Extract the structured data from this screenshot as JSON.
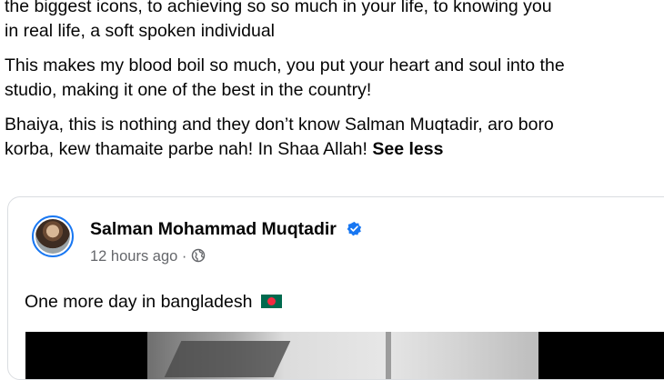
{
  "post": {
    "paragraphs": [
      {
        "lines": [
          "the biggest icons, to achieving so so much in your life, to knowing you",
          "in real life, a soft spoken individual"
        ]
      },
      {
        "lines": [
          "This makes my blood boil so much, you put your heart and soul into the",
          "studio, making it one of the best in the country!"
        ]
      },
      {
        "lines": [
          "Bhaiya, this is nothing and they don’t know Salman Muqtadir, aro boro",
          "korba, kew thamaite parbe nah! In Shaa Allah!"
        ]
      }
    ],
    "see_less_label": "See less"
  },
  "shared_post": {
    "author_name": "Salman Mohammad Muqtadir",
    "author_verified": true,
    "timestamp": "12 hours ago",
    "separator": "·",
    "audience_icon": "globe-icon",
    "caption": "One more day in bangladesh",
    "caption_emoji": "bangladesh-flag-icon"
  },
  "colors": {
    "verified_badge": "#1877f2",
    "meta_text": "#65676b",
    "card_border": "#dadde1",
    "flag_green": "#006a4e",
    "flag_red": "#f42a41"
  }
}
